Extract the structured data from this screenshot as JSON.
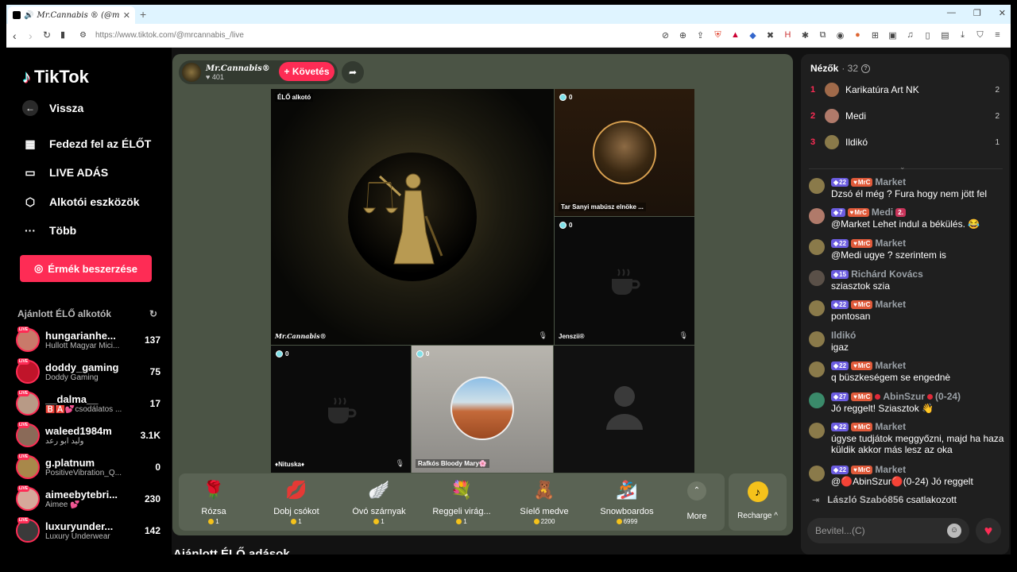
{
  "browser": {
    "tab_title": "Mr.Cannabis ® (@mrcann",
    "url": "https://www.tiktok.com/@mrcannabis_/live"
  },
  "sidebar": {
    "logo": "TikTok",
    "nav": [
      {
        "label": "Vissza",
        "icon": "back-arrow-icon"
      },
      {
        "label": "Fedezd fel az ÉLŐT",
        "icon": "calendar-icon"
      },
      {
        "label": "LIVE ADÁS",
        "icon": "camera-icon"
      },
      {
        "label": "Alkotói eszközök",
        "icon": "play-icon"
      },
      {
        "label": "Több",
        "icon": "more-icon"
      }
    ],
    "coins_button": "Érmék beszerzése",
    "recommended_title": "Ajánlott ÉLŐ alkotók",
    "live_badge": "LIVE",
    "creators": [
      {
        "name": "hungarianhe...",
        "sub": "Hullott Magyar Mici...",
        "count": "137",
        "color": "#c97a6a"
      },
      {
        "name": "doddy_gaming",
        "sub": "Doddy Gaming",
        "count": "75",
        "color": "#c0142a"
      },
      {
        "name": "__dalma__",
        "sub": "🅱️🅰️💕csodálatos ...",
        "count": "17",
        "color": "#b89a86"
      },
      {
        "name": "waleed1984m",
        "sub": "وليد ابو رعد",
        "count": "3.1K",
        "color": "#8a6a58"
      },
      {
        "name": "g.platnum",
        "sub": "PositiveVibration_Q...",
        "count": "0",
        "color": "#a8884a"
      },
      {
        "name": "aimeebytebri...",
        "sub": "Aimee 💕",
        "count": "230",
        "color": "#d6a89a"
      },
      {
        "name": "luxuryunder...",
        "sub": "Luxury Underwear",
        "count": "142",
        "color": "#3a3a3a"
      }
    ]
  },
  "stage": {
    "host_name": "Mr.Cannabis®",
    "host_likes": "401",
    "follow_label": "+ Követés",
    "main_tag": "ÉLŐ alkotó",
    "main_name": "Mr.Cannabis®",
    "guests": [
      {
        "name": "Tar Sanyi mabúsz elnöke ...",
        "count": "0"
      },
      {
        "name": "Jenszii®",
        "count": "0"
      },
      {
        "name": "♦Nituska♦",
        "count": "0"
      },
      {
        "name": "Rafkós Bloody Mary🌸",
        "count": "0"
      }
    ]
  },
  "gifts": [
    {
      "name": "Rózsa",
      "price": "1",
      "icon": "rose-icon",
      "glyph": "🌹"
    },
    {
      "name": "Dobj csókot",
      "price": "1",
      "icon": "lips-icon",
      "glyph": "💋"
    },
    {
      "name": "Óvó szárnyak",
      "price": "1",
      "icon": "wings-icon",
      "glyph": "🪽"
    },
    {
      "name": "Reggeli virág...",
      "price": "1",
      "icon": "flower-icon",
      "glyph": "💐"
    },
    {
      "name": "Síelő medve",
      "price": "2200",
      "icon": "bear-icon",
      "glyph": "🧸"
    },
    {
      "name": "Snowboardos",
      "price": "6999",
      "icon": "snowboarder-icon",
      "glyph": "🏂"
    }
  ],
  "more_label": "More",
  "recharge_label": "Recharge ^",
  "below_title": "Ajánlott ÉLŐ adások",
  "viewers": {
    "title": "Nézők",
    "count": "· 32",
    "top": [
      {
        "rank": "1",
        "name": "Karikatúra Art NK",
        "score": "2",
        "color": "#a06a4a"
      },
      {
        "rank": "2",
        "name": "Medi",
        "score": "2",
        "color": "#b07a6a"
      },
      {
        "rank": "3",
        "name": "Ildikó",
        "score": "1",
        "color": "#8a7a4a"
      }
    ]
  },
  "chat": [
    {
      "name": "Market",
      "level": "22",
      "club": "MrC",
      "text": "Dzsó él még ? Fura hogy nem jött fel",
      "color": "#8a7a4a"
    },
    {
      "name": "Medi",
      "level": "7",
      "club": "MrC",
      "extra": "2.",
      "text": "@Market Lehet indul a békülés. 😂",
      "color": "#b07a6a"
    },
    {
      "name": "Market",
      "level": "22",
      "club": "MrC",
      "text": "@Medi ugye ? szerintem is",
      "color": "#8a7a4a"
    },
    {
      "name": "Richárd Kovács",
      "level": "15",
      "text": "sziasztok szia",
      "color": "#5a5048"
    },
    {
      "name": "Market",
      "level": "22",
      "club": "MrC",
      "text": "pontosan",
      "color": "#8a7a4a"
    },
    {
      "name": "Ildikó",
      "text": "igaz",
      "color": "#8a7a4a"
    },
    {
      "name": "Market",
      "level": "22",
      "club": "MrC",
      "text": "q büszkeségem se engednè",
      "color": "#8a7a4a"
    },
    {
      "name": "AbinSzur",
      "suffix": "(0-24)",
      "level": "27",
      "club": "MrC",
      "text": "Jó reggelt! Sziasztok 👋",
      "color": "#3a8a6a"
    },
    {
      "name": "Market",
      "level": "22",
      "club": "MrC",
      "text": "úgyse tudjátok meggyőzni, majd ha haza küldik akkor más lesz az oka",
      "color": "#8a7a4a"
    },
    {
      "name": "Market",
      "level": "22",
      "club": "MrC",
      "text": "@🔴AbinSzur🔴(0-24) Jó reggelt",
      "color": "#8a7a4a"
    }
  ],
  "joined": {
    "who": "László Szabó856",
    "action": "csatlakozott"
  },
  "input": {
    "placeholder": "Bevitel...(C)"
  },
  "colors": {
    "accent": "#fe2c55",
    "stage_bg": "#4b5445",
    "panel_bg": "#1f1f1f"
  }
}
